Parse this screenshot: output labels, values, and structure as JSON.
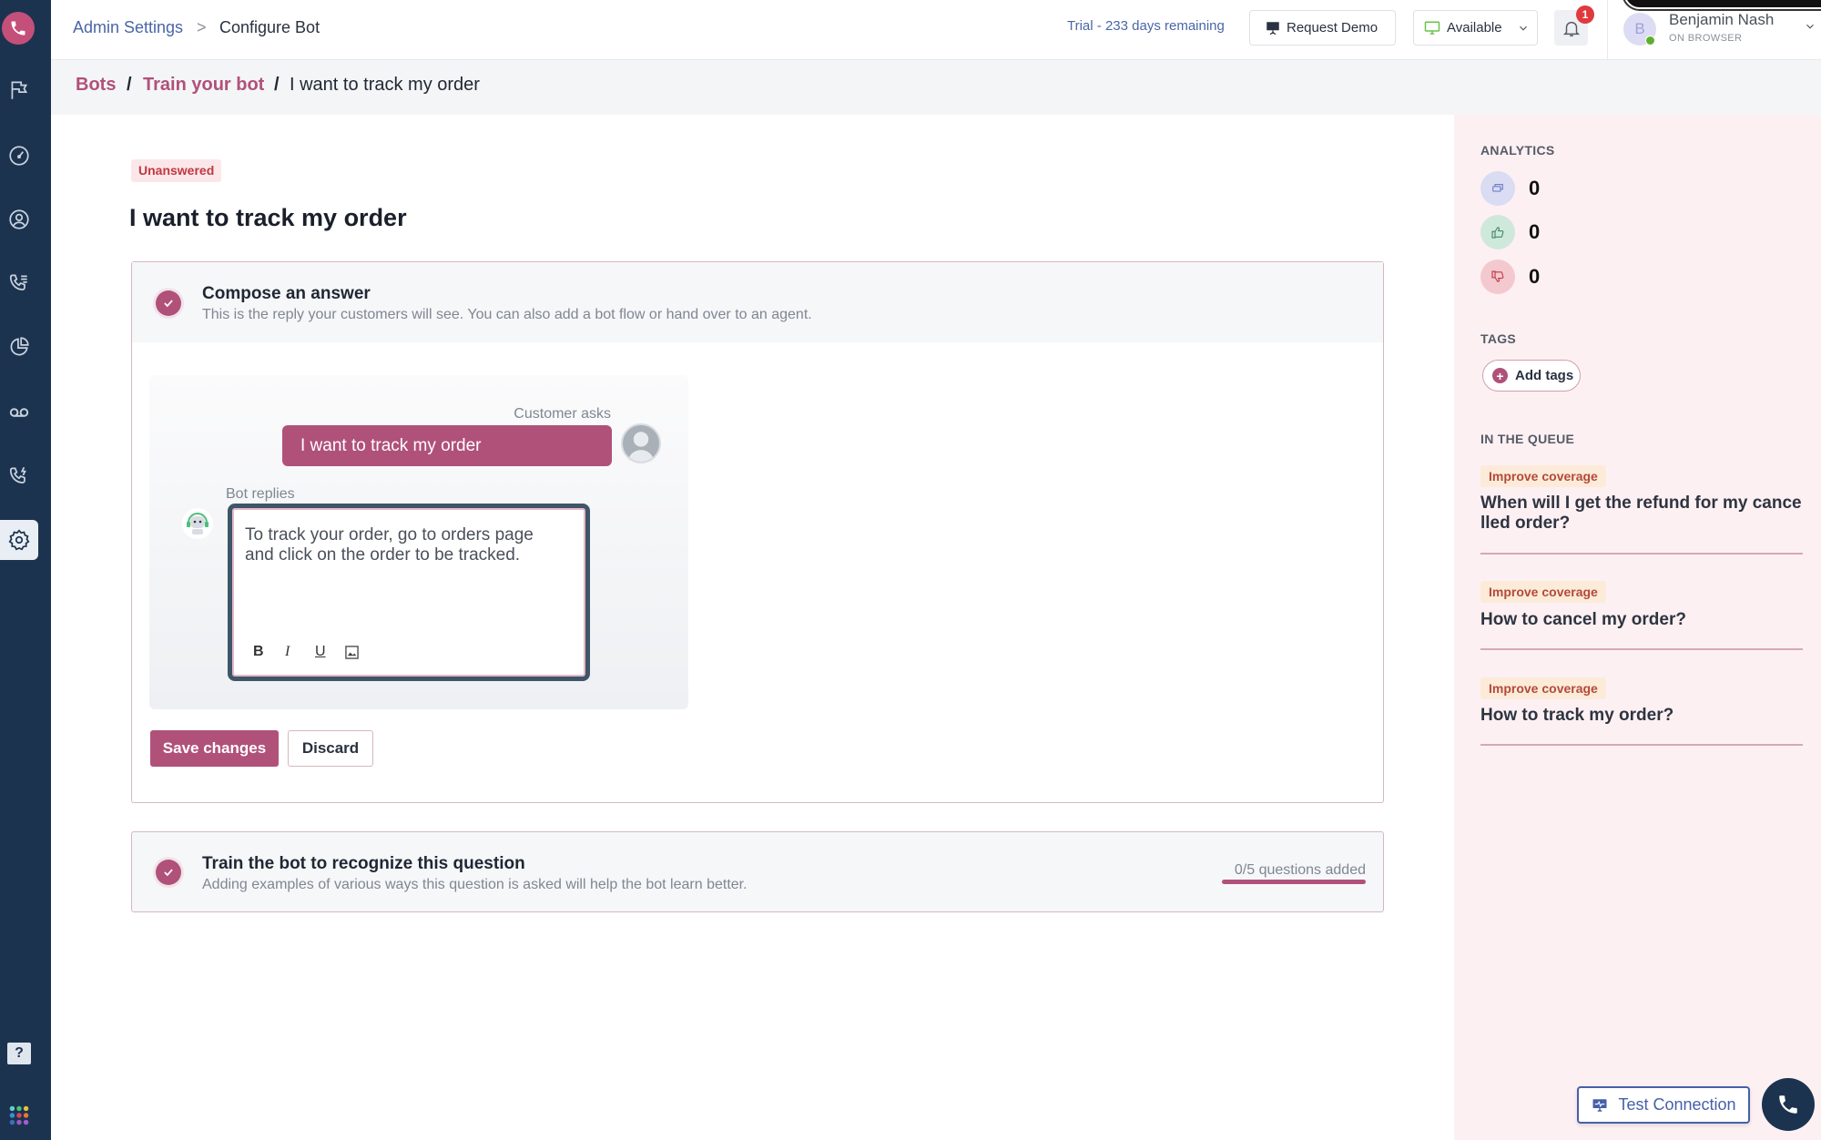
{
  "topbar": {
    "breadcrumb_root": "Admin Settings",
    "breadcrumb_sep": ">",
    "breadcrumb_current": "Configure Bot",
    "trial_text": "Trial - 233 days remaining",
    "request_demo_label": "Request Demo",
    "status_label": "Available",
    "notification_count": "1",
    "user": {
      "initial": "B",
      "name": "Benjamin Nash",
      "status": "ON BROWSER"
    }
  },
  "breadcrumb": {
    "items": [
      "Bots",
      "Train your bot",
      "I want to track my order"
    ],
    "separator": "/"
  },
  "sidebar": {
    "items": [
      {
        "name": "flag-icon"
      },
      {
        "name": "dashboard-gauge-icon"
      },
      {
        "name": "contacts-icon"
      },
      {
        "name": "call-log-icon"
      },
      {
        "name": "reports-pie-icon"
      },
      {
        "name": "voicemail-icon"
      },
      {
        "name": "call-flash-icon"
      },
      {
        "name": "settings-icon",
        "active": true
      }
    ],
    "help_label": "?"
  },
  "main": {
    "status_badge": "Unanswered",
    "title": "I want to track my order",
    "compose": {
      "title": "Compose an answer",
      "subtitle": "This is the reply your customers will see. You can also add a bot flow or hand over to an agent.",
      "customer_label": "Customer asks",
      "customer_message": "I want to track my order",
      "bot_label": "Bot replies",
      "bot_reply": "To track your order, go to orders page and click on the order to be tracked.",
      "toolbar": {
        "bold": "B",
        "italic": "I",
        "underline": "U"
      },
      "save_label": "Save changes",
      "discard_label": "Discard"
    },
    "train": {
      "title": "Train the bot to recognize this question",
      "subtitle": "Adding examples of various ways this question is asked will help the bot learn better.",
      "questions_added": "0/5 questions added",
      "questions_progress": 0
    }
  },
  "right_panel": {
    "analytics_label": "ANALYTICS",
    "analytics": [
      {
        "icon": "conversations-icon",
        "value": "0",
        "color": "#d9dcf2"
      },
      {
        "icon": "thumbs-up-icon",
        "value": "0",
        "color": "#cfe8dc"
      },
      {
        "icon": "thumbs-down-icon",
        "value": "0",
        "color": "#f3c9cf"
      }
    ],
    "tags_label": "TAGS",
    "add_tags_label": "Add tags",
    "queue_label": "IN THE QUEUE",
    "queue": [
      {
        "badge": "Improve coverage",
        "text": "When will I get the refund for my cancelled order?"
      },
      {
        "badge": "Improve coverage",
        "text": "How to cancel my order?"
      },
      {
        "badge": "Improve coverage",
        "text": "How to track my order?"
      }
    ]
  },
  "footer": {
    "test_connection_label": "Test Connection"
  },
  "colors": {
    "brand": "#b0517a",
    "sidebar": "#1c3350",
    "link": "#4a66a8",
    "panel": "#fdf0f3"
  }
}
